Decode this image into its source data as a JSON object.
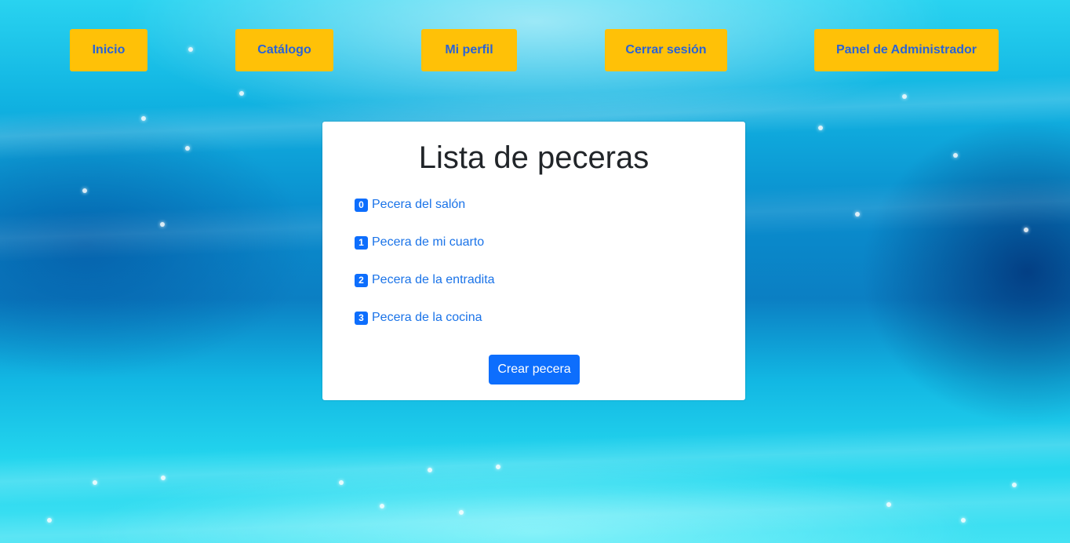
{
  "nav": {
    "items": [
      {
        "label": "Inicio"
      },
      {
        "label": "Catálogo"
      },
      {
        "label": "Mi perfil"
      },
      {
        "label": "Cerrar sesión"
      },
      {
        "label": "Panel de Administrador"
      }
    ]
  },
  "main": {
    "title": "Lista de peceras",
    "tanks": [
      {
        "index": "0",
        "name": "Pecera del salón"
      },
      {
        "index": "1",
        "name": "Pecera de mi cuarto"
      },
      {
        "index": "2",
        "name": "Pecera de la entradita"
      },
      {
        "index": "3",
        "name": "Pecera de la cocina"
      }
    ],
    "create_label": "Crear pecera"
  },
  "colors": {
    "nav_button_bg": "#ffc107",
    "nav_button_text": "#2a63d6",
    "primary": "#0d6efd",
    "link": "#1a73e8"
  }
}
